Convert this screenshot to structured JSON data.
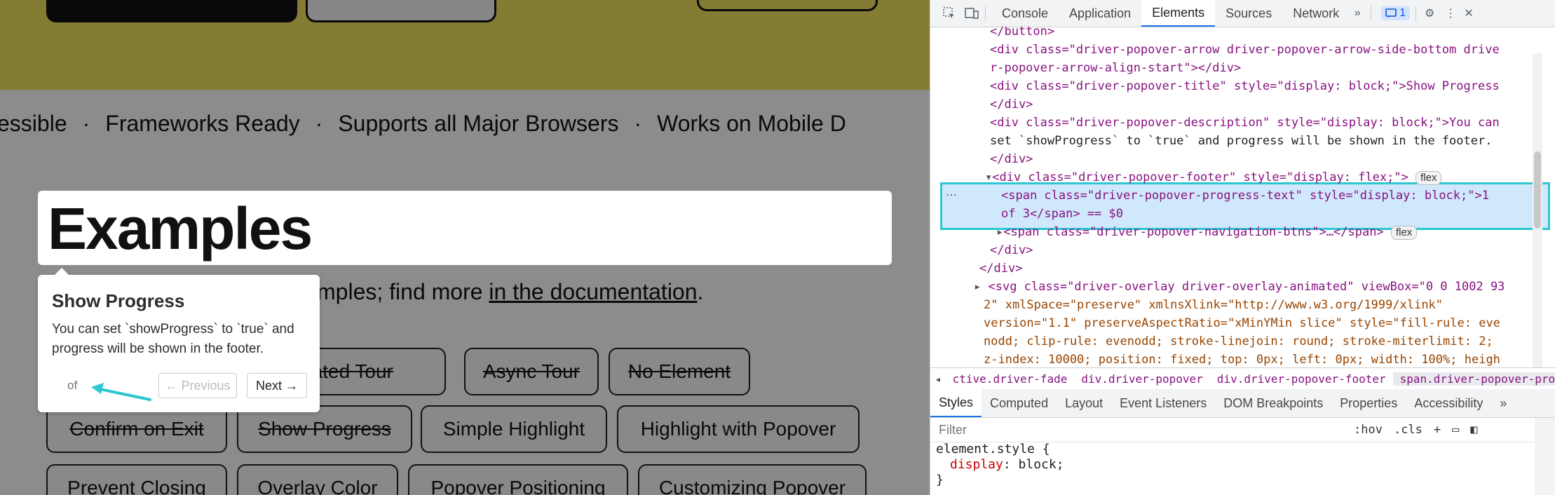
{
  "page": {
    "marquee": [
      "essible",
      "Frameworks Ready",
      "Supports all Major Browsers",
      "Works on Mobile D"
    ],
    "marquee_separator": "·",
    "heading": "Examples",
    "subline_prefix": "mples; find more ",
    "subline_link": "in the documentation",
    "subline_suffix": ".",
    "buttons_row1": [
      "imated Tour",
      "Async Tour",
      "No Element"
    ],
    "buttons_row2": [
      "Confirm on Exit",
      "Show Progress",
      "Simple Highlight",
      "Highlight with Popover"
    ],
    "buttons_row3": [
      "Prevent Closing",
      "Overlay Color",
      "Popover Positioning",
      "Customizing Popover"
    ],
    "colors": {
      "hero": "#f1e25b",
      "overlay": "rgba(0,0,0,0.45)",
      "annotation": "#2cc7cf"
    }
  },
  "popover": {
    "title": "Show Progress",
    "description": "You can set `showProgress` to `true` and progress will be shown in the footer.",
    "progress": "of",
    "prev_label": "← Previous",
    "next_label": "Next →"
  },
  "devtools": {
    "tabs": [
      "Console",
      "Application",
      "Elements",
      "Sources",
      "Network"
    ],
    "active_tab": "Elements",
    "issues_count": "1",
    "dom_lines": [
      {
        "text": "</button>"
      },
      {
        "text": "<div class=\"driver-popover-arrow driver-popover-arrow-side-bottom drive"
      },
      {
        "text": "r-popover-arrow-align-start\"></div>"
      },
      {
        "text": "<div class=\"driver-popover-title\" style=\"display: block;\">Show Progress"
      },
      {
        "text": "</div>"
      },
      {
        "text": "<div class=\"driver-popover-description\" style=\"display: block;\">You can"
      },
      {
        "text": "set `showProgress` to `true` and progress will be shown in the footer."
      },
      {
        "text": "</div>"
      },
      {
        "text": "<div class=\"driver-popover-footer\" style=\"display: flex;\">"
      },
      {
        "text": "<span class=\"driver-popover-progress-text\" style=\"display: block;\">1"
      },
      {
        "text": "of 3</span> == $0"
      },
      {
        "text": "<span class=\"driver-popover-navigation-btns\">…</span>"
      },
      {
        "text": "</div>"
      },
      {
        "text": "</div>"
      },
      {
        "text": "<svg class=\"driver-overlay driver-overlay-animated\" viewBox=\"0 0 1002 93"
      },
      {
        "text": "2\" xmlSpace=\"preserve\" xmlnsXlink=\"http://www.w3.org/1999/xlink\""
      },
      {
        "text": "version=\"1.1\" preserveAspectRatio=\"xMinYMin slice\" style=\"fill-rule: eve"
      },
      {
        "text": "nodd; clip-rule: evenodd; stroke-linejoin: round; stroke-miterlimit: 2;"
      },
      {
        "text": "z-index: 10000; position: fixed; top: 0px; left: 0px; width: 100%; heigh"
      }
    ],
    "flex_badge": "flex",
    "breadcrumbs": [
      "ctive.driver-fade",
      "div.driver-popover",
      "div.driver-popover-footer",
      "span.driver-popover-progress-text"
    ],
    "subtabs": [
      "Styles",
      "Computed",
      "Layout",
      "Event Listeners",
      "DOM Breakpoints",
      "Properties",
      "Accessibility"
    ],
    "active_subtab": "Styles",
    "filter_placeholder": "Filter",
    "filter_tools": [
      ":hov",
      ".cls",
      "+"
    ],
    "styles": {
      "selector": "element.style {",
      "property": "display",
      "value": "block;",
      "close": "}"
    }
  }
}
